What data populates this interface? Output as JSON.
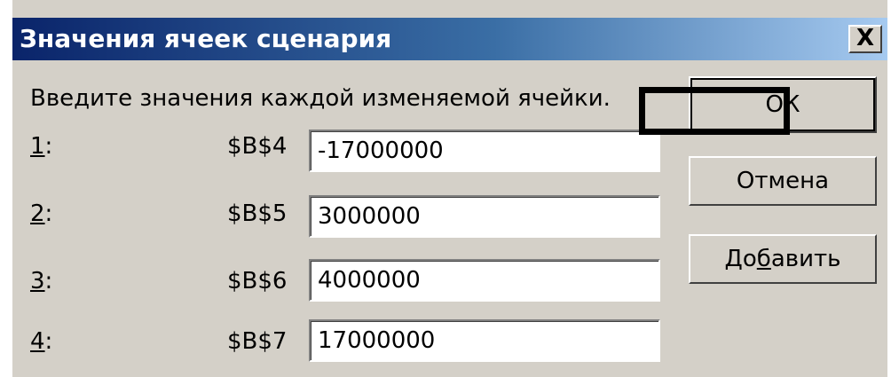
{
  "dialog": {
    "title": "Значения ячеек сценария",
    "close_label": "X",
    "prompt": "Введите значения каждой изменяемой ячейки."
  },
  "rows": [
    {
      "num": "1",
      "ref": "$B$4",
      "value": "-17000000"
    },
    {
      "num": "2",
      "ref": "$B$5",
      "value": "3000000"
    },
    {
      "num": "3",
      "ref": "$B$6",
      "value": "4000000"
    },
    {
      "num": "4",
      "ref": "$B$7",
      "value": "17000000"
    }
  ],
  "buttons": {
    "ok": "ОК",
    "cancel": "Отмена",
    "add_prefix": "До",
    "add_mnemonic": "б",
    "add_suffix": "авить"
  },
  "colors": {
    "titlebar_start": "#0a246a",
    "titlebar_end": "#a6caf0",
    "face": "#d4d0c8"
  }
}
